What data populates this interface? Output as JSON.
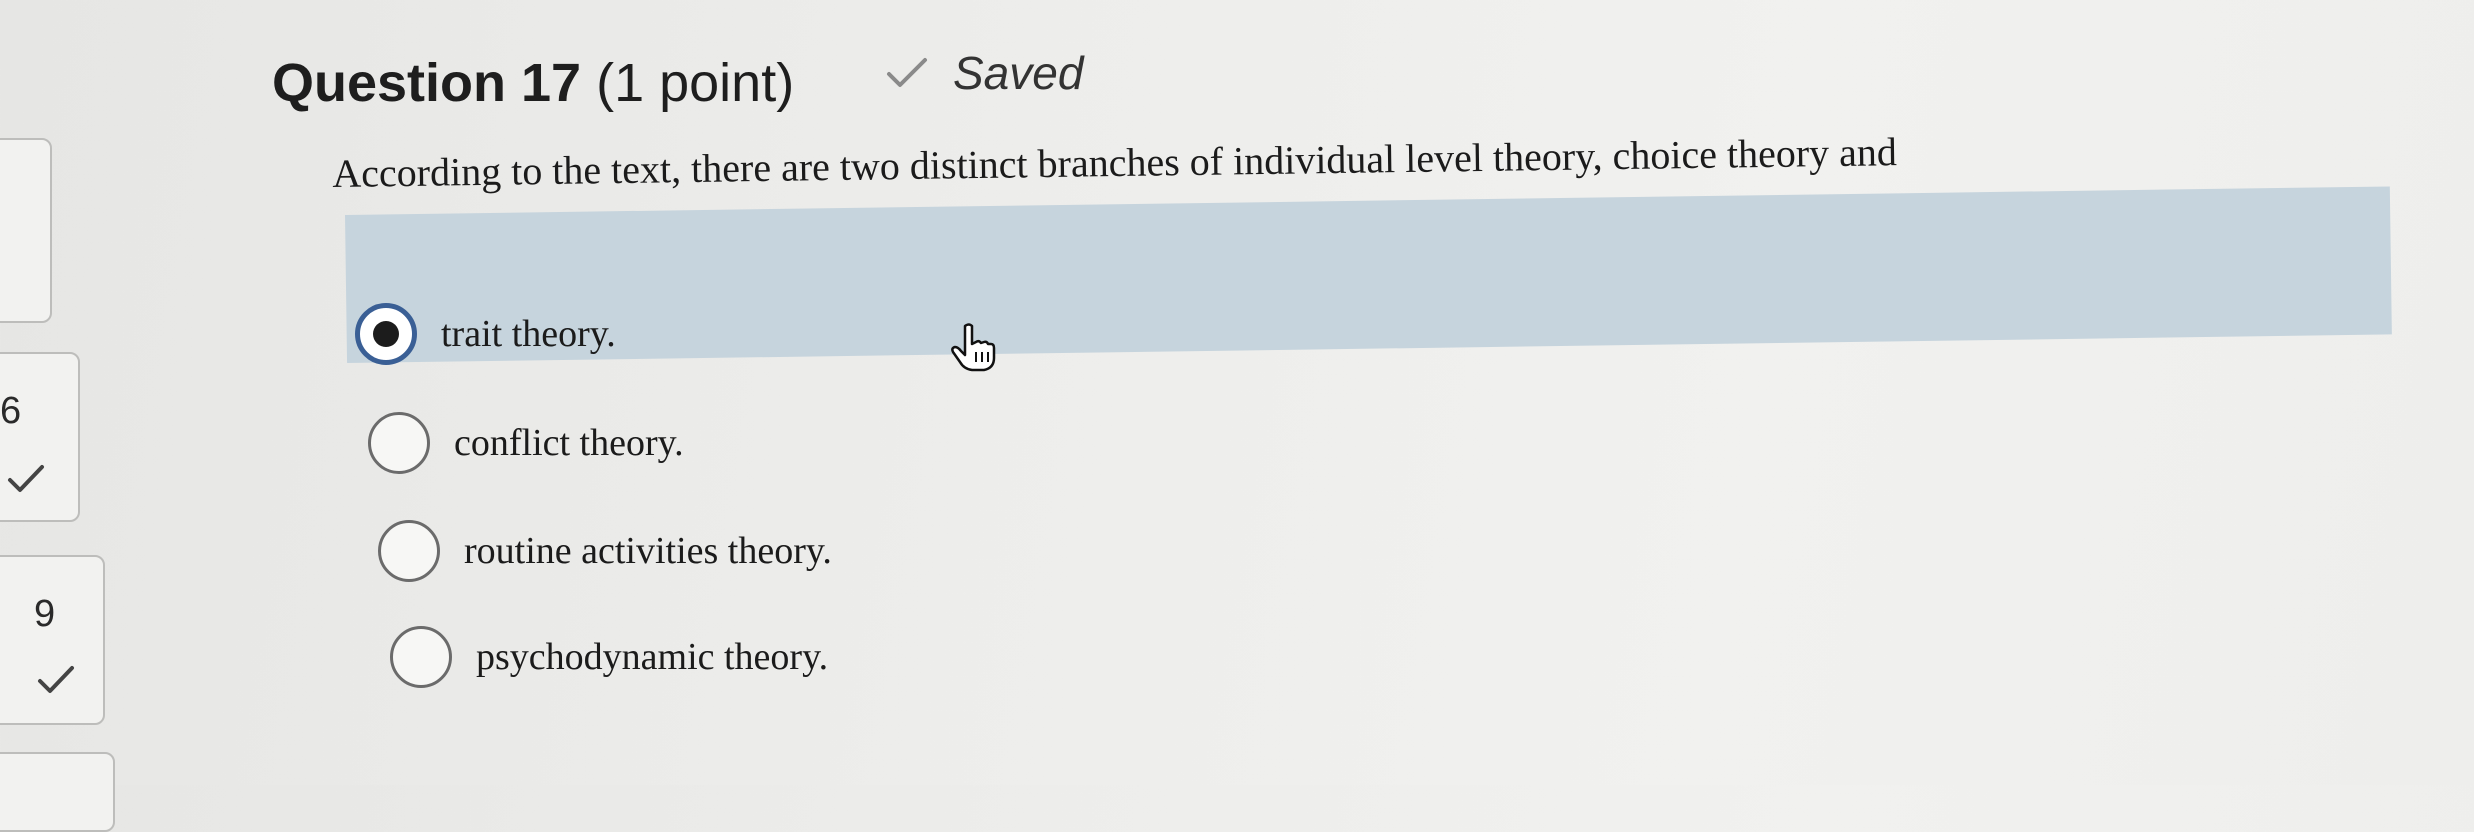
{
  "nav": {
    "tiles": [
      {
        "number": "",
        "answered": true
      },
      {
        "number": "6",
        "answered": true
      },
      {
        "number": "9",
        "answered": true
      }
    ]
  },
  "question": {
    "title": "Question 17",
    "points": "(1 point)",
    "status": "Saved",
    "text": "According to the text, there are two distinct branches of individual level theory, choice theory and",
    "options": [
      {
        "label": "trait theory.",
        "selected": true
      },
      {
        "label": "conflict theory.",
        "selected": false
      },
      {
        "label": "routine activities theory.",
        "selected": false
      },
      {
        "label": "psychodynamic theory.",
        "selected": false
      }
    ]
  },
  "colors": {
    "selected_band": "#c6d4dd",
    "selected_radio_ring": "#3a5f95"
  }
}
